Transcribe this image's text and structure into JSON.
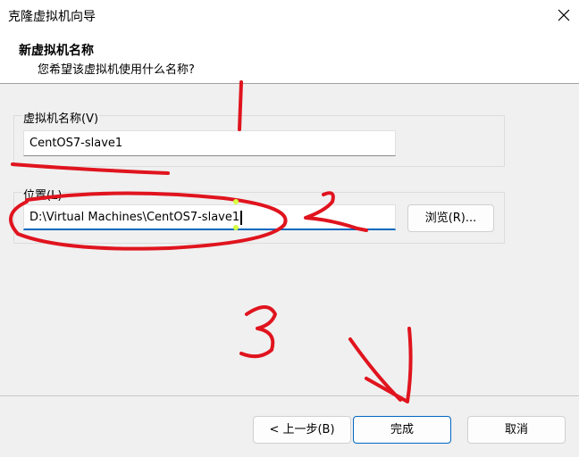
{
  "window": {
    "title": "克隆虚拟机向导",
    "close_icon": "close-icon"
  },
  "header": {
    "title": "新虚拟机名称",
    "subtitle": "您希望该虚拟机使用什么名称?"
  },
  "name_group": {
    "label": "虚拟机名称(V)",
    "value": "CentOS7-slave1"
  },
  "location_group": {
    "label": "位置(L)",
    "value": "D:\\Virtual Machines\\CentOS7-slave1",
    "browse_label": "浏览(R)..."
  },
  "footer": {
    "back_label": "< 上一步(B)",
    "finish_label": "完成",
    "cancel_label": "取消"
  },
  "annotations": {
    "ink_color": "#e0141e"
  },
  "colors": {
    "accent": "#0067c0"
  }
}
